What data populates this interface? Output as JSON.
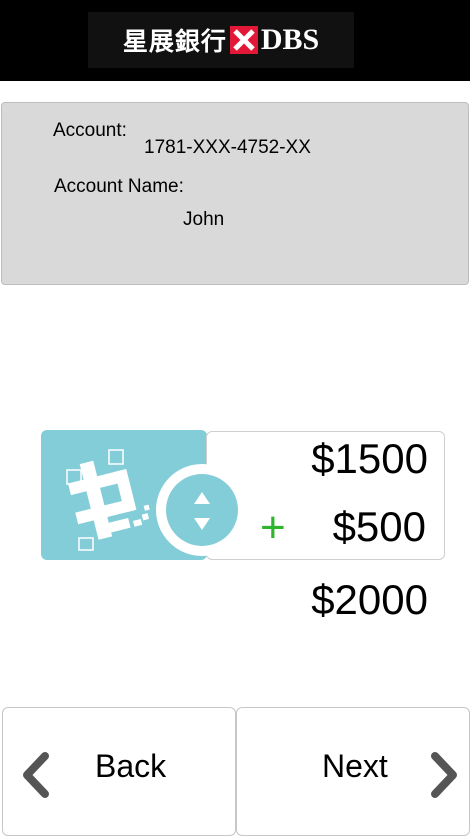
{
  "header": {
    "bank_name_cn": "星展銀行",
    "bank_name_en": "DBS",
    "brand_color": "#e31837"
  },
  "account": {
    "account_label": "Account:",
    "account_number": "1781-XXX-4752-XX",
    "name_label": "Account Name:",
    "name_value": "John"
  },
  "amounts": {
    "existing": "$1500",
    "added": "$500",
    "operator": "+",
    "total": "$2000"
  },
  "icons": {
    "money_card": "cash-note-icon",
    "swap": "up-down-arrows-icon",
    "back": "chevron-left-icon",
    "next": "chevron-right-icon"
  },
  "colors": {
    "accent": "#83cdd8",
    "plus_green": "#2db52d"
  },
  "nav": {
    "back_label": "Back",
    "next_label": "Next"
  }
}
